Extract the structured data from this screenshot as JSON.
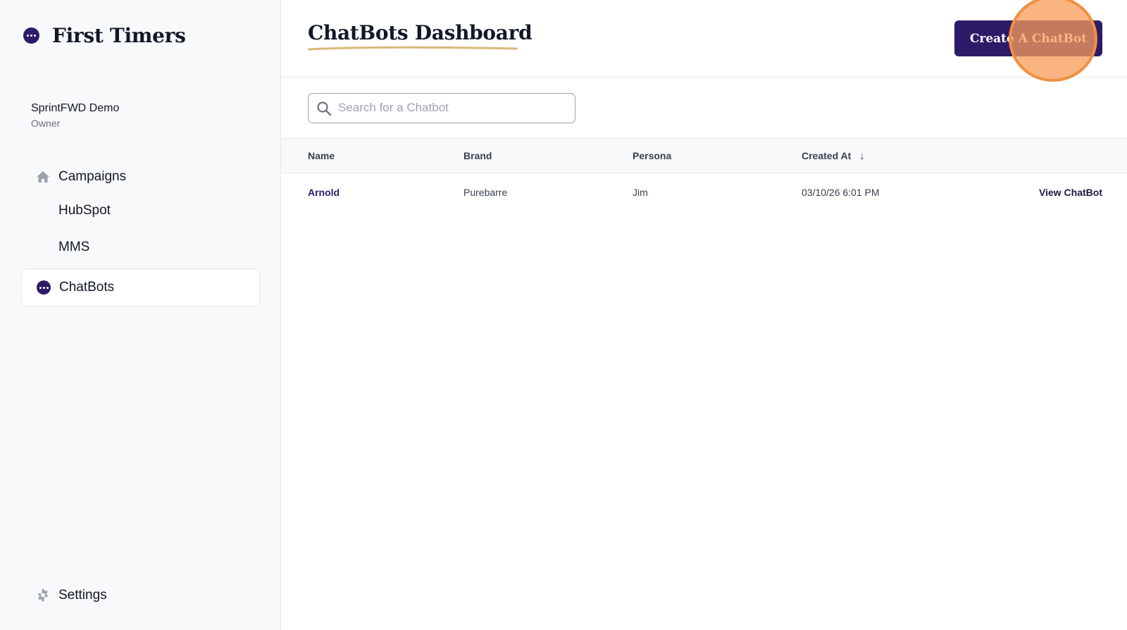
{
  "app": {
    "name": "First Timers"
  },
  "account": {
    "name": "SprintFWD Demo",
    "role": "Owner"
  },
  "sidebar": {
    "items": [
      {
        "label": "Campaigns",
        "icon": "home-icon"
      },
      {
        "label": "HubSpot"
      },
      {
        "label": "MMS"
      },
      {
        "label": "ChatBots",
        "icon": "chat-bubble-icon",
        "active": true
      }
    ],
    "settings": {
      "label": "Settings",
      "icon": "gear-icon"
    }
  },
  "header": {
    "title": "ChatBots Dashboard",
    "create_button": "Create A ChatBot"
  },
  "search": {
    "placeholder": "Search for a Chatbot",
    "value": ""
  },
  "table": {
    "columns": [
      "Name",
      "Brand",
      "Persona",
      "Created At"
    ],
    "sort_indicator": "↓",
    "rows": [
      {
        "name": "Arnold",
        "brand": "Purebarre",
        "persona": "Jim",
        "created_at": "03/10/26 6:01 PM",
        "action": "View ChatBot"
      }
    ]
  },
  "colors": {
    "brand_primary": "#2d1b69",
    "click_highlight": "#f0913f",
    "title_underline": "#d9b878"
  }
}
